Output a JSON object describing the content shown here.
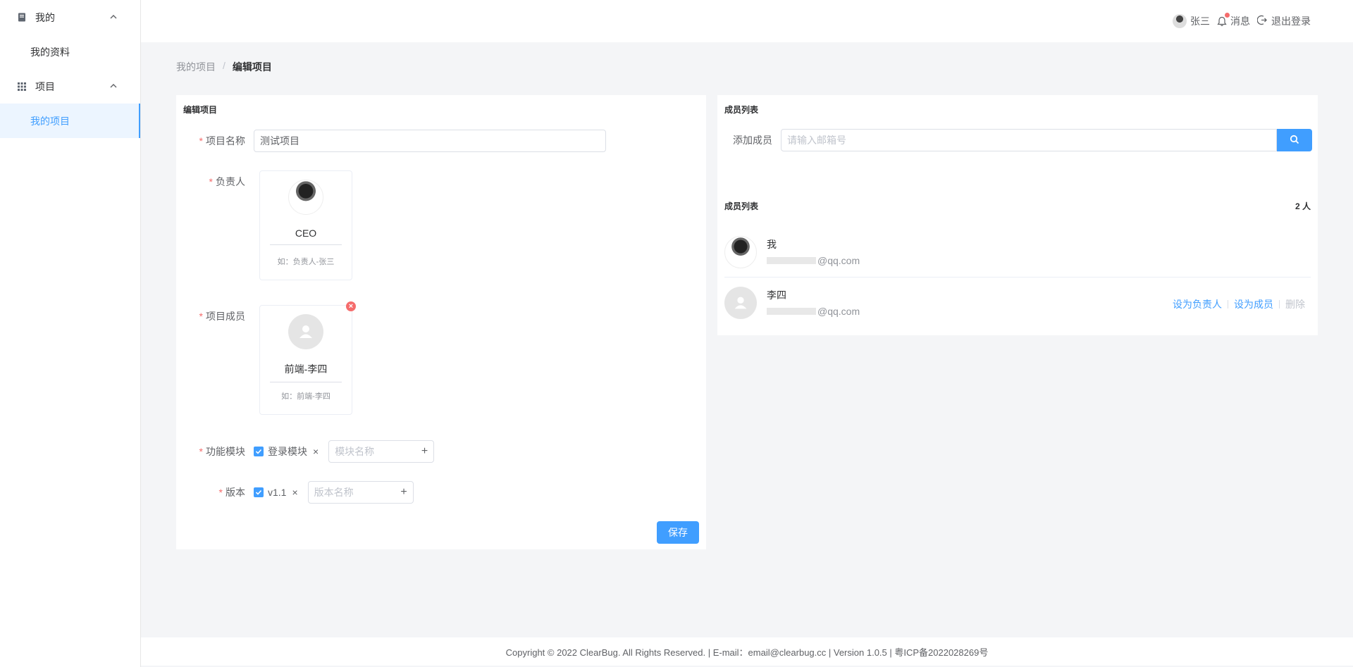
{
  "sidebar": {
    "groups": [
      {
        "label": "我的",
        "icon": "book-icon",
        "items": [
          {
            "label": "我的资料"
          }
        ]
      },
      {
        "label": "项目",
        "icon": "grid-icon",
        "items": [
          {
            "label": "我的项目",
            "active": true
          }
        ]
      }
    ]
  },
  "header": {
    "user": "张三",
    "messages": "消息",
    "logout": "退出登录"
  },
  "breadcrumb": {
    "parent": "我的项目",
    "sep": "/",
    "current": "编辑项目"
  },
  "edit": {
    "title": "编辑项目",
    "name_label": "项目名称",
    "name_value": "测试项目",
    "owner_label": "负责人",
    "owner": {
      "role": "CEO",
      "hint": "如：负责人-张三"
    },
    "members_label": "项目成员",
    "member": {
      "role": "前端-李四",
      "hint": "如：前端-李四"
    },
    "modules_label": "功能模块",
    "module_tag": "登录模块",
    "module_placeholder": "模块名称",
    "version_label": "版本",
    "version_tag": "v1.1",
    "version_placeholder": "版本名称",
    "save": "保存"
  },
  "members_panel": {
    "title": "成员列表",
    "add_label": "添加成员",
    "add_placeholder": "请输入邮箱号",
    "list_title": "成员列表",
    "count": "2 人",
    "list": [
      {
        "name": "我",
        "email": "@qq.com"
      },
      {
        "name": "李四",
        "email": "@qq.com",
        "actions": [
          "设为负责人",
          "设为成员",
          "删除"
        ]
      }
    ]
  },
  "footer": "Copyright © 2022 ClearBug. All Rights Reserved. | E-mail：email@clearbug.cc | Version 1.0.5 | 粤ICP备2022028269号"
}
